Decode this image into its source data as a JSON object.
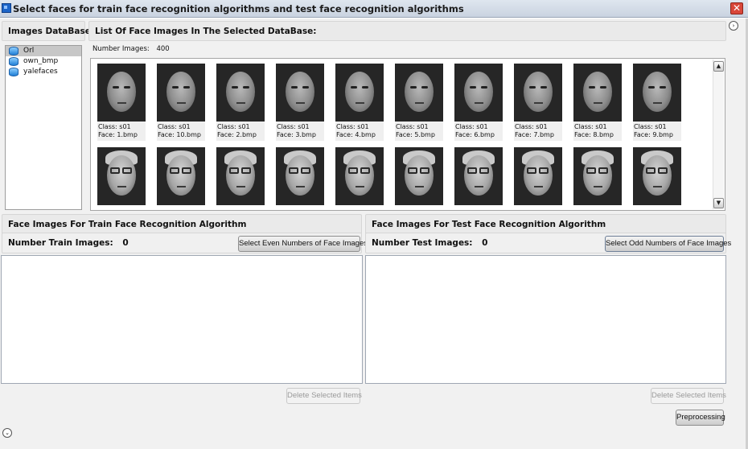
{
  "window": {
    "title": "Select faces for train face recognition algorithms and test face recognition algorithms",
    "close_label": "✕"
  },
  "left_panel": {
    "header": "Images DataBase List:",
    "items": [
      {
        "label": "Orl",
        "selected": true
      },
      {
        "label": "own_bmp",
        "selected": false
      },
      {
        "label": "yalefaces",
        "selected": false
      }
    ]
  },
  "faces_panel": {
    "header": "List Of Face Images In The Selected DataBase:",
    "number_label": "Number Images:",
    "number_value": "400",
    "rows": [
      [
        {
          "cls": "Class: s01",
          "face": "Face:  1.bmp"
        },
        {
          "cls": "Class: s01",
          "face": "Face:  10.bmp"
        },
        {
          "cls": "Class: s01",
          "face": "Face:  2.bmp"
        },
        {
          "cls": "Class: s01",
          "face": "Face:  3.bmp"
        },
        {
          "cls": "Class: s01",
          "face": "Face:  4.bmp"
        },
        {
          "cls": "Class: s01",
          "face": "Face:  5.bmp"
        },
        {
          "cls": "Class: s01",
          "face": "Face:  6.bmp"
        },
        {
          "cls": "Class: s01",
          "face": "Face:  7.bmp"
        },
        {
          "cls": "Class: s01",
          "face": "Face:  8.bmp"
        },
        {
          "cls": "Class: s01",
          "face": "Face:  9.bmp"
        }
      ]
    ]
  },
  "train": {
    "header": "Face Images For Train Face Recognition Algorithm",
    "count_label": "Number Train Images:",
    "count_value": "0",
    "select_button": "Select Even Numbers of Face Images",
    "delete_button": "Delete Selected Items"
  },
  "test": {
    "header": "Face Images For Test Face Recognition Algorithm",
    "count_label": "Number Test Images:",
    "count_value": "0",
    "select_button": "Select Odd Numbers of Face Images",
    "delete_button": "Delete Selected Items"
  },
  "footer": {
    "preprocessing_button": "Preprocessing"
  }
}
